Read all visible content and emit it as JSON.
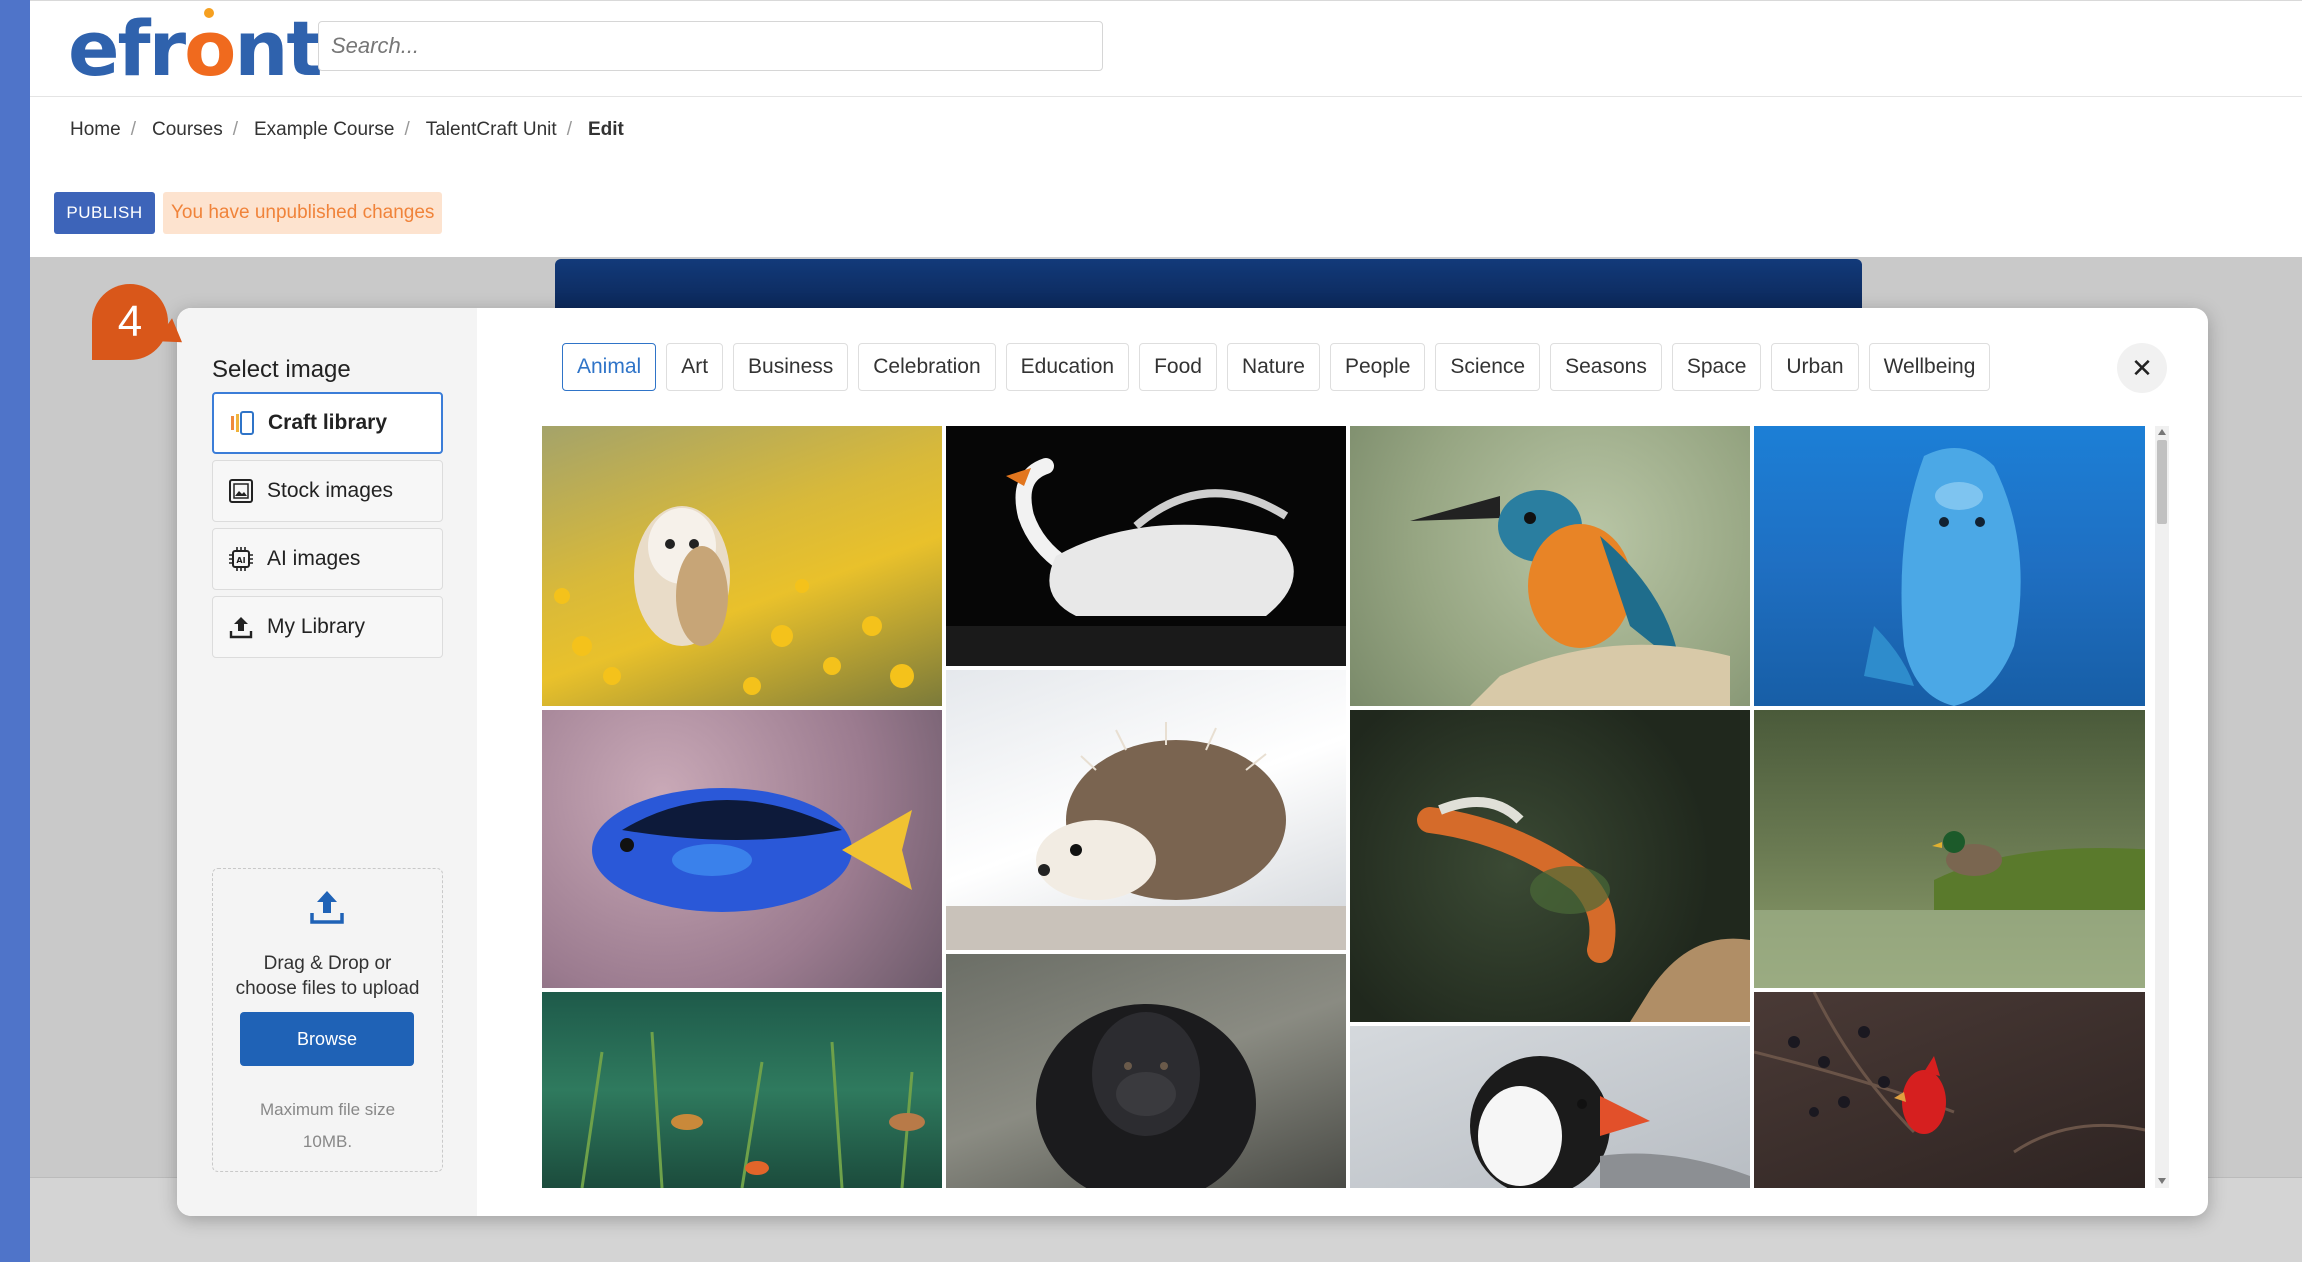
{
  "header": {
    "logo_text_pre": "efr",
    "logo_text_o": "o",
    "logo_text_post": "nt",
    "search_placeholder": "Search..."
  },
  "breadcrumb": {
    "items": [
      "Home",
      "Courses",
      "Example Course",
      "TalentCraft Unit"
    ],
    "separator": "/",
    "current": "Edit"
  },
  "editor": {
    "publish_label": "PUBLISH",
    "unpublished_notice": "You have unpublished changes"
  },
  "tour": {
    "step_number": "4"
  },
  "modal": {
    "title": "Select image",
    "sources": [
      {
        "label": "Craft library",
        "icon": "craft-library-icon",
        "active": true
      },
      {
        "label": "Stock images",
        "icon": "stock-images-icon",
        "active": false
      },
      {
        "label": "AI images",
        "icon": "ai-chip-icon",
        "active": false
      },
      {
        "label": "My Library",
        "icon": "upload-icon",
        "active": false
      }
    ],
    "upload": {
      "line1": "Drag & Drop or",
      "line2": "choose files to upload",
      "browse_label": "Browse",
      "note_line1": "Maximum file size",
      "note_line2": "10MB."
    },
    "categories": [
      "Animal",
      "Art",
      "Business",
      "Celebration",
      "Education",
      "Food",
      "Nature",
      "People",
      "Science",
      "Seasons",
      "Space",
      "Urban",
      "Wellbeing"
    ],
    "active_category": "Animal",
    "close_symbol": "✕",
    "images": [
      {
        "name": "owl-image",
        "subject": "barn owl in yellow flowers"
      },
      {
        "name": "swan-image",
        "subject": "white swan on dark water"
      },
      {
        "name": "kingfisher-image",
        "subject": "kingfisher on branch"
      },
      {
        "name": "dolphin-image",
        "subject": "dolphin underwater"
      },
      {
        "name": "tang-fish-image",
        "subject": "blue tang fish"
      },
      {
        "name": "hedgehog-image",
        "subject": "hedgehog"
      },
      {
        "name": "koi-image",
        "subject": "koi fish in pond"
      },
      {
        "name": "duck-image",
        "subject": "mallard duck on grass"
      },
      {
        "name": "pond-image",
        "subject": "green pond with fish"
      },
      {
        "name": "gorilla-image",
        "subject": "gorilla"
      },
      {
        "name": "puffin-image",
        "subject": "puffin"
      },
      {
        "name": "cardinal-image",
        "subject": "red cardinal on branch"
      }
    ]
  },
  "colors": {
    "brand_blue": "#2f62ad",
    "brand_orange": "#f06a1e",
    "accent": "#2f74c8",
    "publish_bg": "#3d64b9",
    "notice_bg": "#fde3cf",
    "notice_text": "#f0833a",
    "step_badge": "#d9571a"
  }
}
